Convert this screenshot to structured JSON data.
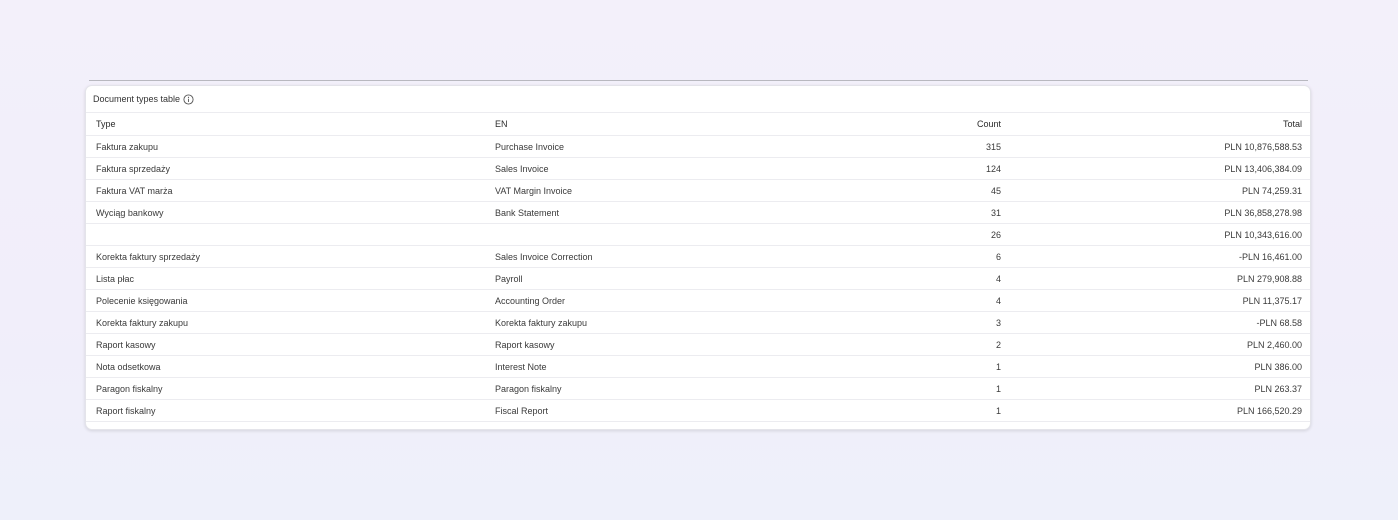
{
  "table": {
    "title": "Document types table",
    "info_icon": "info-circle-icon",
    "columns": {
      "type": "Type",
      "en": "EN",
      "count": "Count",
      "total": "Total"
    },
    "rows": [
      {
        "type": "Faktura zakupu",
        "en": "Purchase Invoice",
        "count": "315",
        "total": "PLN 10,876,588.53"
      },
      {
        "type": "Faktura sprzedaży",
        "en": "Sales Invoice",
        "count": "124",
        "total": "PLN 13,406,384.09"
      },
      {
        "type": "Faktura VAT marża",
        "en": "VAT Margin Invoice",
        "count": "45",
        "total": "PLN 74,259.31"
      },
      {
        "type": "Wyciąg bankowy",
        "en": "Bank Statement",
        "count": "31",
        "total": "PLN 36,858,278.98"
      },
      {
        "type": "",
        "en": "",
        "count": "26",
        "total": "PLN 10,343,616.00"
      },
      {
        "type": "Korekta faktury sprzedaży",
        "en": "Sales Invoice Correction",
        "count": "6",
        "total": "-PLN 16,461.00"
      },
      {
        "type": "Lista płac",
        "en": "Payroll",
        "count": "4",
        "total": "PLN 279,908.88"
      },
      {
        "type": "Polecenie księgowania",
        "en": "Accounting Order",
        "count": "4",
        "total": "PLN 11,375.17"
      },
      {
        "type": "Korekta faktury zakupu",
        "en": "Korekta faktury zakupu",
        "count": "3",
        "total": "-PLN 68.58"
      },
      {
        "type": "Raport kasowy",
        "en": "Raport kasowy",
        "count": "2",
        "total": "PLN 2,460.00"
      },
      {
        "type": "Nota odsetkowa",
        "en": "Interest Note",
        "count": "1",
        "total": "PLN 386.00"
      },
      {
        "type": "Paragon fiskalny",
        "en": "Paragon fiskalny",
        "count": "1",
        "total": "PLN 263.37"
      },
      {
        "type": "Raport fiskalny",
        "en": "Fiscal Report",
        "count": "1",
        "total": "PLN 166,520.29"
      }
    ]
  }
}
